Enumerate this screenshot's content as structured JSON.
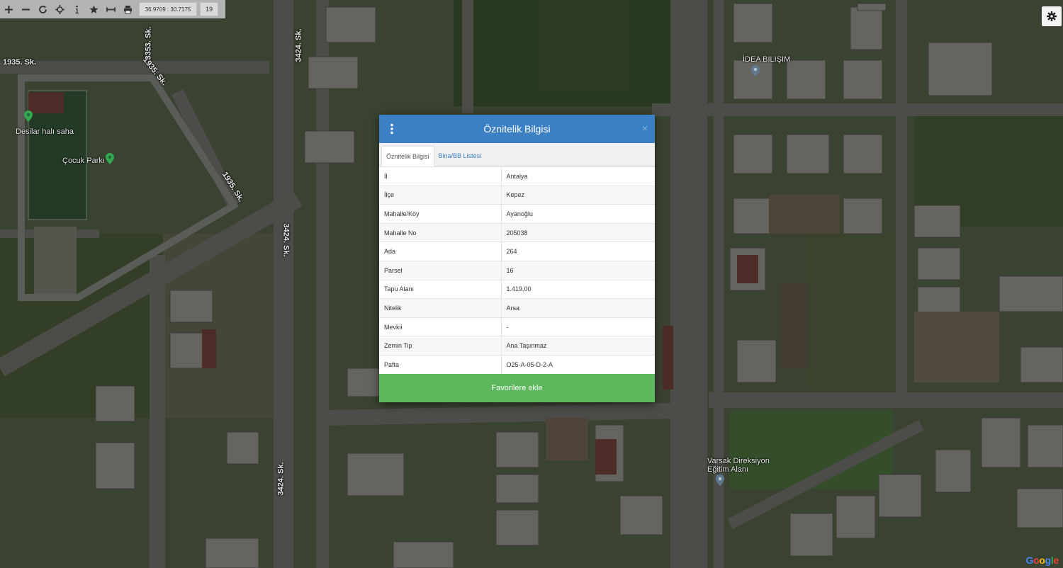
{
  "toolbar": {
    "buttons": [
      {
        "name": "zoom-in-button",
        "icon": "plus-icon"
      },
      {
        "name": "zoom-out-button",
        "icon": "minus-icon"
      },
      {
        "name": "refresh-button",
        "icon": "refresh-icon"
      },
      {
        "name": "locate-button",
        "icon": "crosshair-icon"
      },
      {
        "name": "info-button",
        "icon": "info-icon"
      },
      {
        "name": "favorites-button",
        "icon": "star-icon"
      },
      {
        "name": "measure-button",
        "icon": "ruler-icon"
      },
      {
        "name": "print-button",
        "icon": "print-icon"
      }
    ],
    "coordinates": "36.9709 : 30.7175",
    "zoom_level": "19"
  },
  "map": {
    "street_labels": [
      "1935. Sk.",
      "1935. Sk.",
      "1935. Sk.",
      "3353. Sk.",
      "3424. Sk.",
      "3424. Sk.",
      "3424. Sk."
    ],
    "places": [
      "Desilar halı saha",
      "Çocuk Parkı",
      "İDEA BILIŞIM",
      "Varsak Direksiyon\nEğitim Alanı"
    ],
    "attribution": "Google"
  },
  "modal": {
    "title": "Öznitelik Bilgisi",
    "tabs": [
      "Öznitelik Bilgisi",
      "Bina/BB Listesi"
    ],
    "rows": [
      {
        "key": "İl",
        "value": "Antalya"
      },
      {
        "key": "İlçe",
        "value": "Kepez"
      },
      {
        "key": "Mahalle/Köy",
        "value": "Ayanoğlu"
      },
      {
        "key": "Mahalle No",
        "value": "205038"
      },
      {
        "key": "Ada",
        "value": "264"
      },
      {
        "key": "Parsel",
        "value": "16"
      },
      {
        "key": "Tapu Alanı",
        "value": "1.419,00"
      },
      {
        "key": "Nitelik",
        "value": "Arsa"
      },
      {
        "key": "Mevkii",
        "value": "-"
      },
      {
        "key": "Zemin Tip",
        "value": "Ana Taşınmaz"
      },
      {
        "key": "Pafta",
        "value": "O25-A-05-D-2-A"
      }
    ],
    "favorite_button": "Favorilere ekle",
    "close_symbol": "×"
  },
  "colors": {
    "header": "#3b7fc4",
    "button": "#5cb85c",
    "link": "#3b7fc4"
  }
}
